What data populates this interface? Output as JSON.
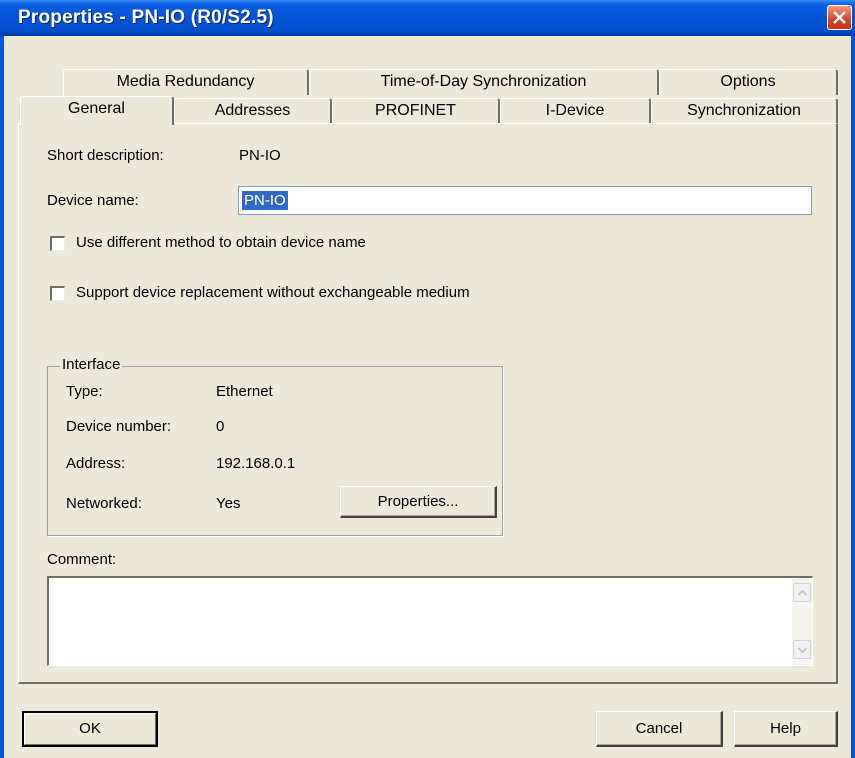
{
  "window": {
    "title": "Properties - PN-IO (R0/S2.5)"
  },
  "tabs_back": [
    {
      "label": "Media Redundancy"
    },
    {
      "label": "Time-of-Day Synchronization"
    },
    {
      "label": "Options"
    }
  ],
  "tabs_front": [
    {
      "label": "General",
      "active": true
    },
    {
      "label": "Addresses"
    },
    {
      "label": "PROFINET"
    },
    {
      "label": "I-Device"
    },
    {
      "label": "Synchronization"
    }
  ],
  "general": {
    "short_description_label": "Short description:",
    "short_description_value": "PN-IO",
    "device_name_label": "Device name:",
    "device_name_value": "PN-IO",
    "checkbox_method_label": "Use different method to obtain device name",
    "checkbox_method_checked": false,
    "checkbox_replacement_label": "Support device replacement without exchangeable medium",
    "checkbox_replacement_checked": false
  },
  "interface": {
    "legend": "Interface",
    "type_label": "Type:",
    "type_value": "Ethernet",
    "device_number_label": "Device number:",
    "device_number_value": "0",
    "address_label": "Address:",
    "address_value": "192.168.0.1",
    "networked_label": "Networked:",
    "networked_value": "Yes",
    "properties_button": "Properties..."
  },
  "comment": {
    "label": "Comment:",
    "value": ""
  },
  "buttons": {
    "ok": "OK",
    "cancel": "Cancel",
    "help": "Help"
  },
  "colors": {
    "titlebar": "#0454d8",
    "face": "#ece9d8",
    "selection": "#316ac5",
    "close": "#d6442a"
  }
}
